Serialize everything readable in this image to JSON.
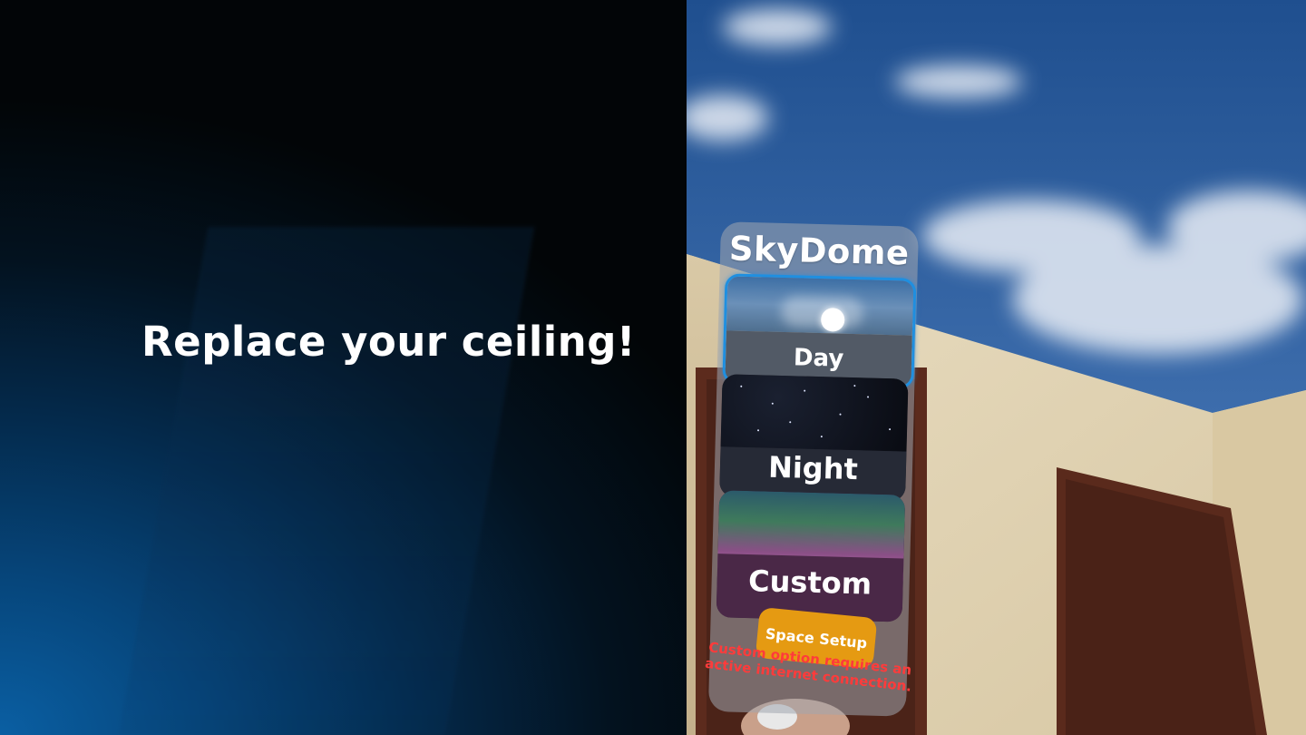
{
  "headline": "Replace your ceiling!",
  "app": {
    "title": "SkyDome",
    "options": [
      {
        "label": "Day",
        "selected": true
      },
      {
        "label": "Night",
        "selected": false
      },
      {
        "label": "Custom",
        "selected": false
      }
    ],
    "space_setup_label": "Space Setup",
    "warning": "Custom option requires an active internet connection."
  },
  "colors": {
    "selected_border": "#1f8fe0",
    "space_setup_button": "#e59a12",
    "warning_text": "#ff3b3b"
  },
  "icons": [
    "sun-icon"
  ]
}
